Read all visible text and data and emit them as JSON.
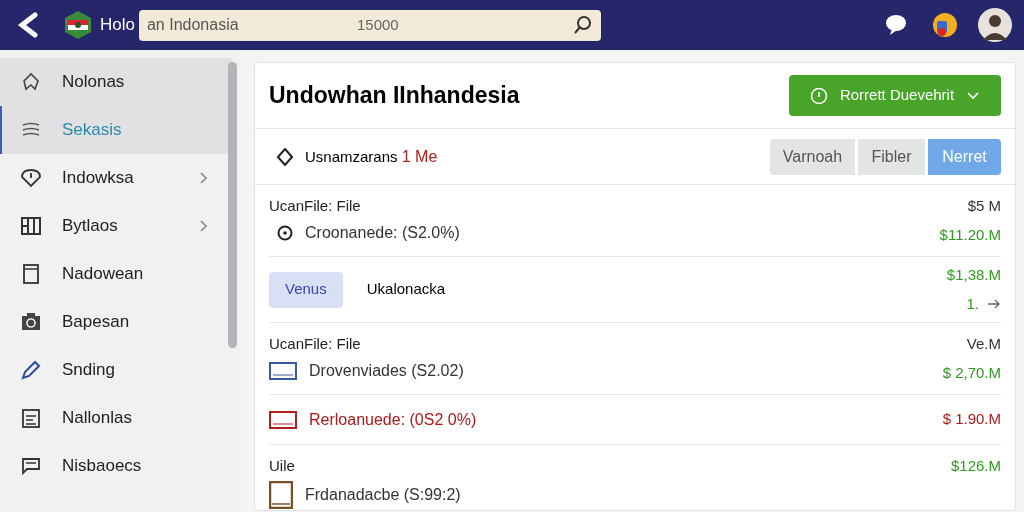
{
  "header": {
    "brand": "Holo",
    "search_value": "an Indonasia",
    "search_count": "15000"
  },
  "sidebar": {
    "items": [
      {
        "label": "Nolonas",
        "selected": false,
        "has_children": false
      },
      {
        "label": "Sekasis",
        "selected": true,
        "has_children": false
      },
      {
        "label": "Indowksa",
        "selected": false,
        "has_children": true
      },
      {
        "label": "Bytlaos",
        "selected": false,
        "has_children": true
      },
      {
        "label": "Nadowean",
        "selected": false,
        "has_children": false
      },
      {
        "label": "Bapesan",
        "selected": false,
        "has_children": false
      },
      {
        "label": "Snding",
        "selected": false,
        "has_children": false
      },
      {
        "label": "Nallonlas",
        "selected": false,
        "has_children": false
      },
      {
        "label": "Nisbaoecs",
        "selected": false,
        "has_children": false
      }
    ]
  },
  "card": {
    "title": "Undowhan IInhandesia",
    "primary_button": "Rorrett Duevehrit",
    "filter_label": "Usnamzarans ",
    "filter_highlight": "1 Me",
    "segments": [
      {
        "label": "Varnoah",
        "selected": false
      },
      {
        "label": "Fibler",
        "selected": false
      },
      {
        "label": "Nerret",
        "selected": true
      }
    ],
    "rows": [
      {
        "kind": "file",
        "title": "UcanFile: File",
        "title_amount": "$5 M",
        "subtitle": "Croonanede: (S2.0%)",
        "amount": "$11.20.M",
        "color": "#2e9a1e"
      },
      {
        "kind": "tag",
        "tag": "Venus",
        "text": "Ukalonacka",
        "amount": "$1,38.M",
        "color": "#2e9a1e",
        "sub": "1."
      },
      {
        "kind": "file",
        "title": "UcanFile: File",
        "title_amount": "Ve.M",
        "subtitle": "Drovenviades (S2.02)",
        "amount": "$ 2,70.M",
        "color": "#2e9a1e"
      },
      {
        "kind": "single",
        "subtitle": "Rerloanuede: (0S2 0%)",
        "amount": "$ 1.90.M",
        "color": "#b01818"
      },
      {
        "kind": "file",
        "title": "Uile",
        "subtitle": "Frdanadacbe (S:99:2)",
        "amount": "$126.M",
        "color": "#2e9a1e"
      }
    ]
  }
}
